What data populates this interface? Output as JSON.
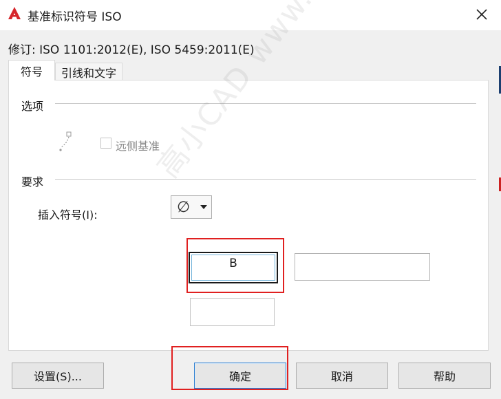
{
  "window": {
    "title": "基准标识符号 ISO",
    "icon": "autocad-logo-icon",
    "accent_color": "#d6262b"
  },
  "revision": "修订: ISO 1101:2012(E), ISO 5459:2011(E)",
  "tabs": [
    {
      "label": "符号",
      "active": true
    },
    {
      "label": "引线和文字",
      "active": false
    }
  ],
  "options_group": {
    "title": "选项",
    "far_side_datum": {
      "label": "远侧基准",
      "checked": false,
      "enabled": false,
      "icon": "far-datum-icon"
    }
  },
  "requirements_group": {
    "title": "要求",
    "insert_symbol_label": "插入符号(I):",
    "insert_symbol_value": "∅"
  },
  "datum_fields": [
    {
      "value": "B",
      "focused": true
    },
    {
      "value": ""
    },
    {
      "value": ""
    }
  ],
  "buttons": {
    "settings": "设置(S)...",
    "ok": "确定",
    "cancel": "取消",
    "help": "帮助"
  },
  "watermark": "高小CAD www.zzcad.com",
  "highlight_color": "#e02020"
}
